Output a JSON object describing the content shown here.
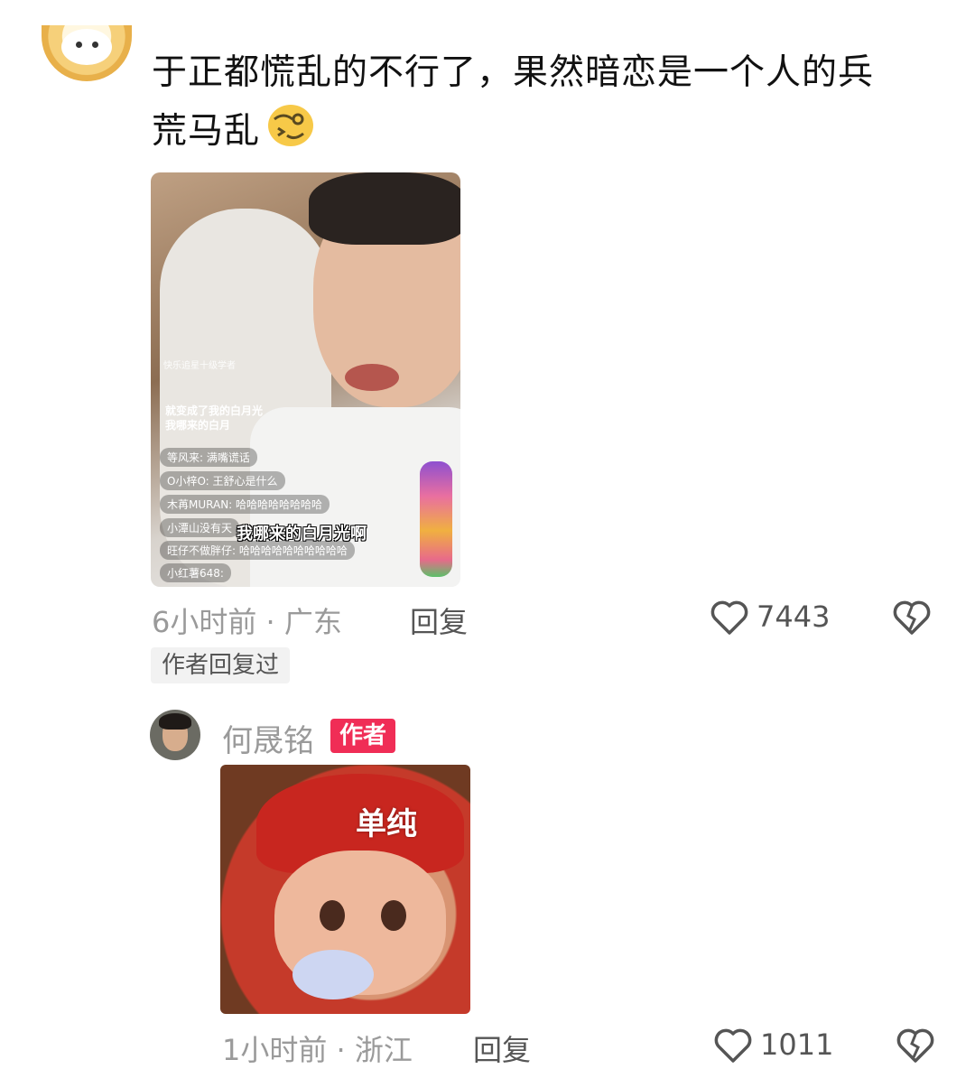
{
  "comment": {
    "text_line1": "于正都慌乱的不行了，果然暗恋是一个人的兵",
    "text_line2": "荒马乱",
    "emoji": "dizzy-face-emoji",
    "video": {
      "watermark": "快乐追星十级学者",
      "caption_line1": "就变成了我的白月光",
      "caption_line2": "我哪来的白月",
      "chat": [
        "等风来: 满嘴谎话",
        "O小梓O: 王舒心是什么",
        "木苒MURAN: 哈哈哈哈哈哈哈哈",
        "小潭山没有天",
        "旺仔不做胖仔: 哈哈哈哈哈哈哈哈哈哈",
        "小红薯648: "
      ],
      "subtitle": "我哪来的白月光啊"
    },
    "time": "6小时前 · 广东",
    "reply_label": "回复",
    "likes": "7443",
    "author_replied": "作者回复过"
  },
  "reply": {
    "username": "何晟铭",
    "badge": "作者",
    "sticker_text": "单纯",
    "time": "1小时前 · 浙江",
    "reply_label": "回复",
    "likes": "1011"
  },
  "colors": {
    "badge": "#f02d56",
    "meta": "#9a9a9a"
  }
}
